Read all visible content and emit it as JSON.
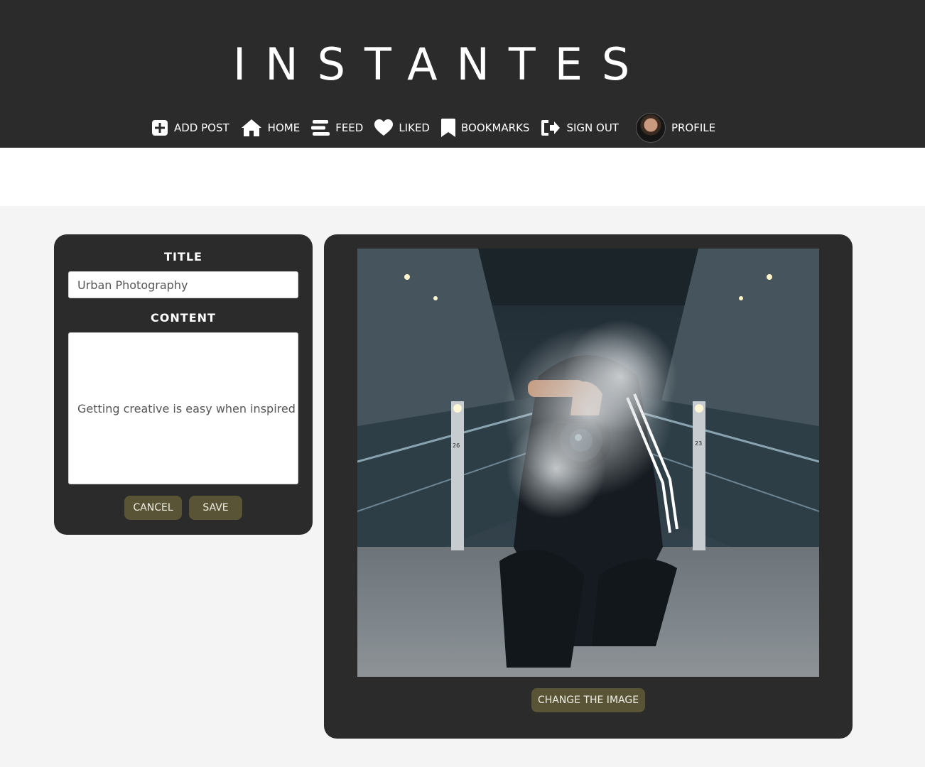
{
  "app": {
    "brand": "INSTANTES"
  },
  "nav": {
    "items": [
      {
        "label": "ADD POST",
        "icon": "plus-square-icon"
      },
      {
        "label": "HOME",
        "icon": "home-icon"
      },
      {
        "label": "FEED",
        "icon": "feed-icon"
      },
      {
        "label": "LIKED",
        "icon": "heart-icon"
      },
      {
        "label": "BOOKMARKS",
        "icon": "bookmark-icon"
      },
      {
        "label": "SIGN OUT",
        "icon": "sign-out-icon"
      }
    ],
    "profile_label": "PROFILE"
  },
  "form": {
    "title_label": "TITLE",
    "title_value": "Urban Photography",
    "content_label": "CONTENT",
    "content_value": "Getting creative is easy when inspired",
    "cancel_label": "CANCEL",
    "save_label": "SAVE"
  },
  "image_panel": {
    "change_label": "CHANGE THE IMAGE",
    "escalator_left_number": "26",
    "escalator_right_number": "23"
  },
  "colors": {
    "header_bg": "#2b2b2b",
    "card_bg": "#2b2b2b",
    "button_bg": "#5a5436",
    "page_bg": "#f4f4f4"
  }
}
